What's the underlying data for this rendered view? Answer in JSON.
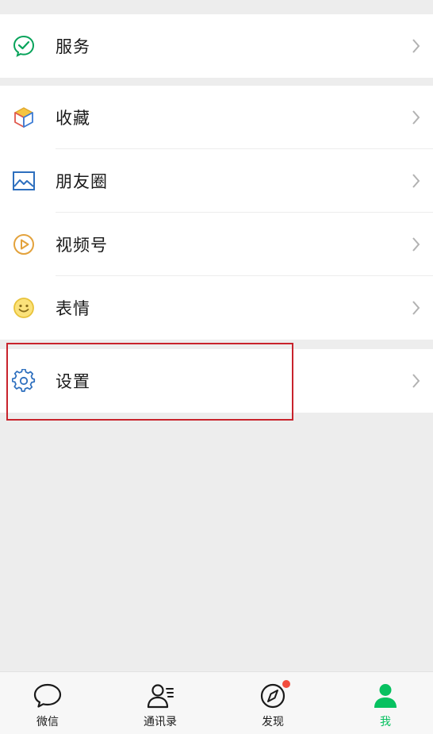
{
  "menu": {
    "service": {
      "label": "服务",
      "icon": "wechat-pay-check-icon"
    },
    "favorites": {
      "label": "收藏",
      "icon": "cube-icon"
    },
    "moments": {
      "label": "朋友圈",
      "icon": "picture-icon"
    },
    "channels": {
      "label": "视频号",
      "icon": "play-circle-icon"
    },
    "stickers": {
      "label": "表情",
      "icon": "smiley-icon"
    },
    "settings": {
      "label": "设置",
      "icon": "gear-icon"
    }
  },
  "tabbar": {
    "chats": {
      "label": "微信",
      "icon": "chat-bubble-icon"
    },
    "contacts": {
      "label": "通讯录",
      "icon": "contacts-icon"
    },
    "discover": {
      "label": "发现",
      "icon": "compass-icon",
      "badge": true
    },
    "me": {
      "label": "我",
      "icon": "person-icon",
      "active": true
    }
  },
  "colors": {
    "accent": "#07c160",
    "highlight_border": "#c8232c",
    "badge": "#f24c3d",
    "background": "#ededed"
  }
}
